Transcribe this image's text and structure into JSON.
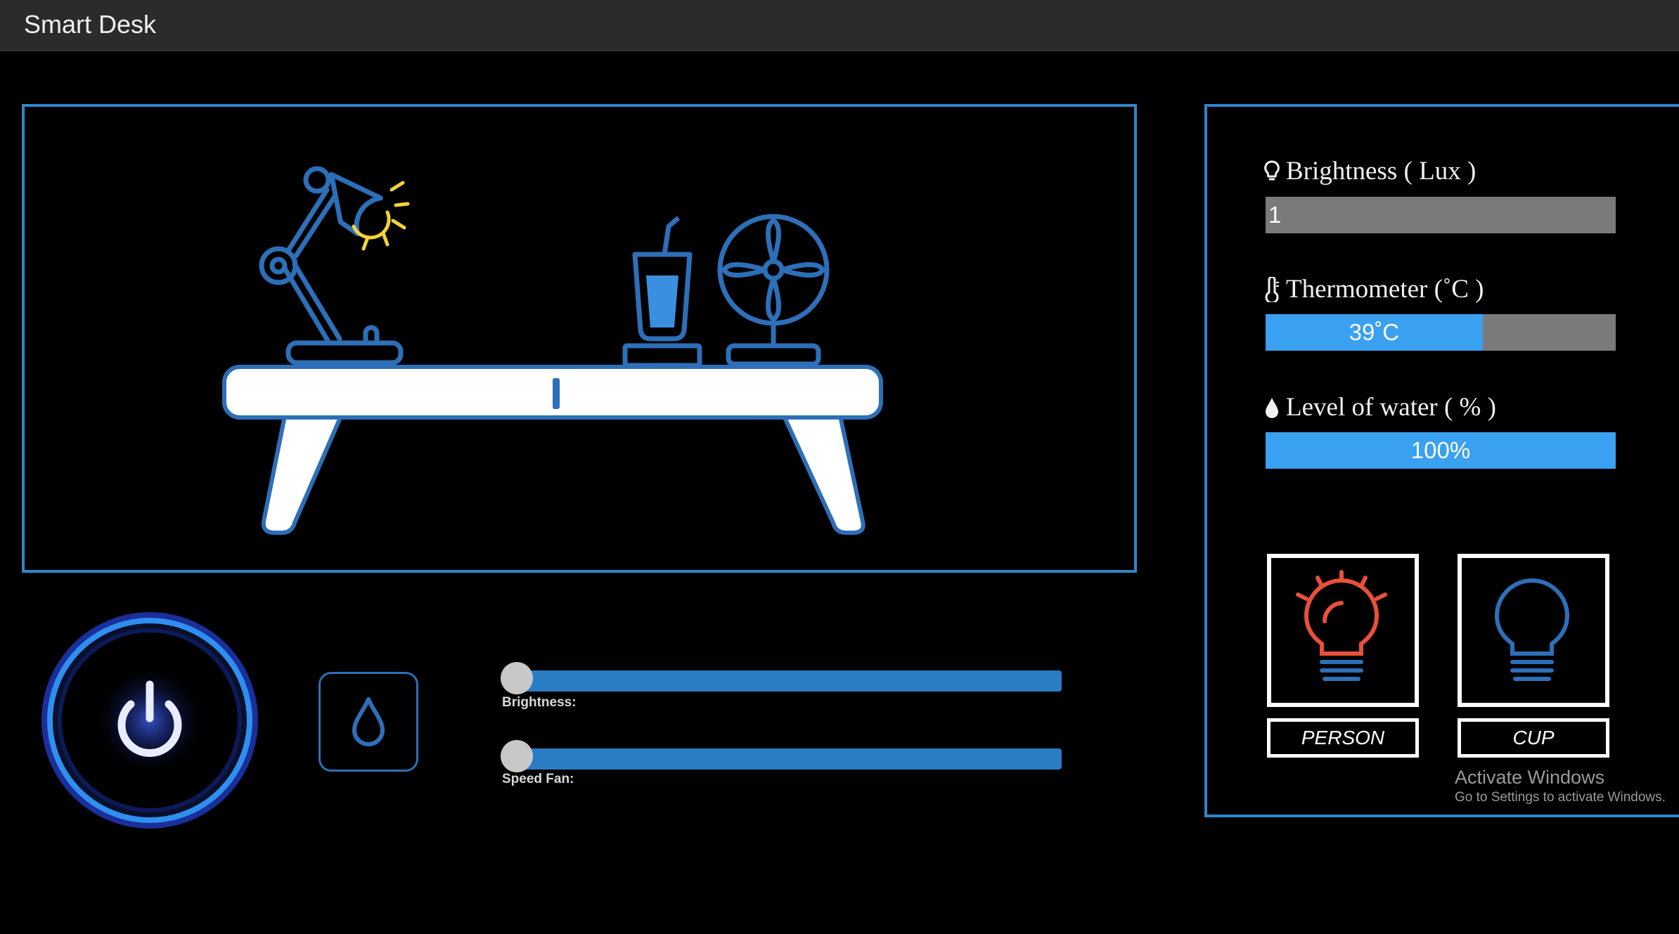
{
  "window": {
    "title": "Smart Desk"
  },
  "scene": {
    "icons": [
      "desk-lamp-icon",
      "drink-cup-icon",
      "electric-fan-icon",
      "table-icon"
    ],
    "colors": {
      "outline": "#2d6fb8",
      "lamp_light": "#f2d33a",
      "table_fill": "#ffffff"
    }
  },
  "controls": {
    "power_icon": "power-icon",
    "water_icon": "water-drop-icon",
    "brightness_slider": {
      "label": "Brightness:",
      "value_fraction": 0.0
    },
    "fan_slider": {
      "label": "Speed Fan:",
      "value_fraction": 0.0
    }
  },
  "sensors": {
    "brightness": {
      "label": "Brightness ( Lux )",
      "value": "1",
      "fill_fraction": 0.0,
      "icon": "bulb-icon"
    },
    "thermometer": {
      "label": "Thermometer (˚C )",
      "value": "39˚C",
      "fill_fraction": 0.62,
      "icon": "thermometer-icon"
    },
    "water": {
      "label": "Level of water ( % )",
      "value": "100%",
      "fill_fraction": 1.0,
      "icon": "water-drop-icon"
    }
  },
  "detections": [
    {
      "label": "PERSON",
      "state": "on",
      "color": "#e8503a",
      "icon": "bulb-on-icon"
    },
    {
      "label": "CUP",
      "state": "off",
      "color": "#2d6fb8",
      "icon": "bulb-off-icon"
    }
  ],
  "watermark": {
    "line1": "Activate Windows",
    "line2": "Go to Settings to activate Windows."
  },
  "accent": "#2f86c9"
}
